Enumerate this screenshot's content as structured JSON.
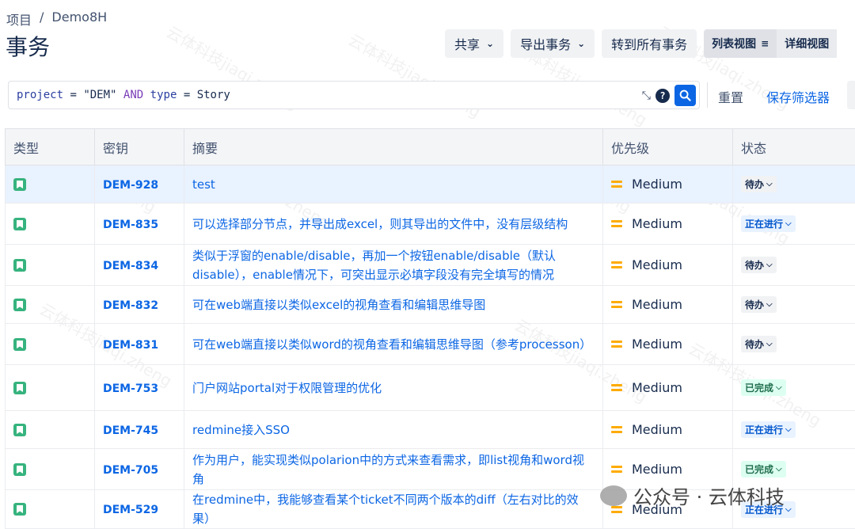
{
  "breadcrumb": {
    "project": "项目",
    "separator": "/",
    "name": "Demo8H"
  },
  "page_title": "事务",
  "toolbar": {
    "share": "共享",
    "export": "导出事务",
    "goto_all": "转到所有事务",
    "list_view": "列表视图",
    "detail_view": "详细视图"
  },
  "jql": {
    "field1": "project",
    "eq1": "=",
    "value1": "\"DEM\"",
    "and": "AND",
    "field2": "type",
    "eq2": "=",
    "value2": "Story"
  },
  "actions": {
    "reset": "重置",
    "save_filter": "保存筛选器"
  },
  "table": {
    "headers": {
      "type": "类型",
      "key": "密钥",
      "summary": "摘要",
      "priority": "优先级",
      "status": "状态"
    },
    "rows": [
      {
        "key": "DEM-928",
        "summary": "test",
        "priority": "Medium",
        "status": "待办",
        "status_kind": "todo"
      },
      {
        "key": "DEM-835",
        "summary": "可以选择部分节点，并导出成excel，则其导出的文件中，没有层级结构",
        "priority": "Medium",
        "status": "正在进行",
        "status_kind": "inprog"
      },
      {
        "key": "DEM-834",
        "summary": "类似于浮窗的enable/disable，再加一个按钮enable/disable（默认disable），enable情况下，可突出显示必填字段没有完全填写的情况",
        "priority": "Medium",
        "status": "待办",
        "status_kind": "todo"
      },
      {
        "key": "DEM-832",
        "summary": "可在web端直接以类似excel的视角查看和编辑思维导图",
        "priority": "Medium",
        "status": "待办",
        "status_kind": "todo"
      },
      {
        "key": "DEM-831",
        "summary": "可在web端直接以类似word的视角查看和编辑思维导图（参考processon）",
        "priority": "Medium",
        "status": "待办",
        "status_kind": "todo"
      },
      {
        "key": "DEM-753",
        "summary": "门户网站portal对于权限管理的优化",
        "priority": "Medium",
        "status": "已完成",
        "status_kind": "done"
      },
      {
        "key": "DEM-745",
        "summary": "redmine接入SSO",
        "priority": "Medium",
        "status": "正在进行",
        "status_kind": "inprog"
      },
      {
        "key": "DEM-705",
        "summary": "作为用户，能实现类似polarion中的方式来查看需求，即list视角和word视角",
        "priority": "Medium",
        "status": "已完成",
        "status_kind": "done"
      },
      {
        "key": "DEM-529",
        "summary": "在redmine中，我能够查看某个ticket不同两个版本的diff（左右对比的效果）",
        "priority": "Medium",
        "status": "正在进行",
        "status_kind": "inprog"
      }
    ]
  },
  "watermark": {
    "text": "云体科技jiaqi.zheng"
  },
  "brand": {
    "text": "公众号 · 云体科技"
  },
  "colors": {
    "link": "#0c66e4",
    "story": "#36b37e",
    "priority_medium": "#ffab00"
  }
}
